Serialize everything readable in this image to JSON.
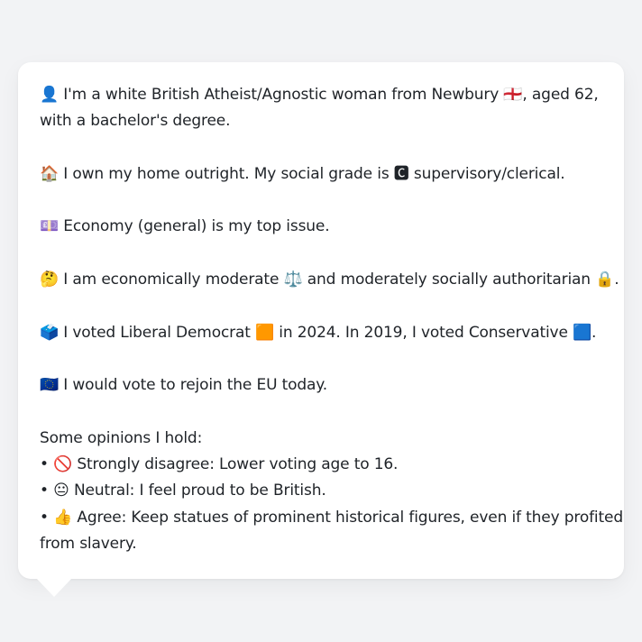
{
  "persona": {
    "identity_line1": "👤 I'm a white British Atheist/Agnostic woman from Newbury 🏴󠁧󠁢󠁥󠁮󠁧󠁿, aged 62,",
    "identity_line2": "with a bachelor's degree.",
    "home_line": "🏠 I own my home outright. My social grade is 🅲 supervisory/clerical.",
    "issue_line": "💷 Economy (general) is my top issue.",
    "ideology_line": "🤔 I am economically moderate ⚖️ and moderately socially authoritarian 🔒.",
    "vote_line": "🗳️ I voted Liberal Democrat 🟧 in 2024. In 2019, I voted Conservative 🟦.",
    "eu_line": "🇪🇺 I would vote to rejoin the EU today."
  },
  "opinions": {
    "heading": "Some opinions I hold:",
    "items": [
      "• 🚫 Strongly disagree: Lower voting age to 16.",
      "• 😐 Neutral: I feel proud to be British.",
      "• 👍 Agree: Keep statues of prominent historical figures, even if they profited"
    ],
    "item3_continuation": "from slavery."
  }
}
